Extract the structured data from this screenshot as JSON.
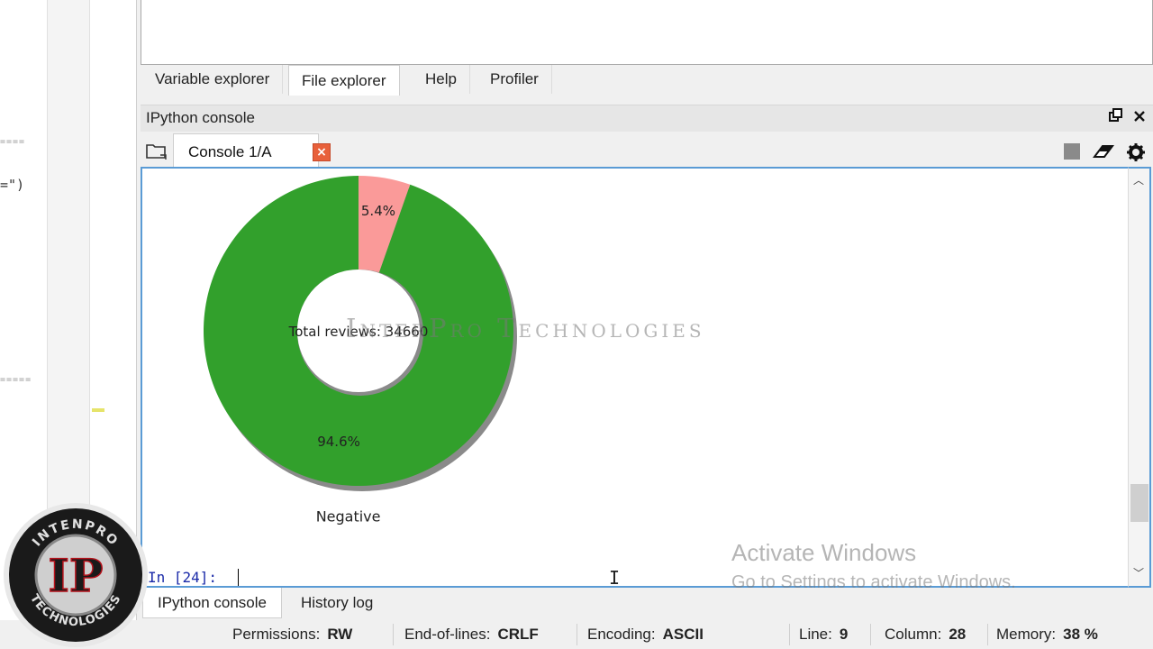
{
  "editor": {
    "fragment": "=\")"
  },
  "top_tabs": [
    {
      "label": "Variable explorer",
      "active": false
    },
    {
      "label": "File explorer",
      "active": true
    },
    {
      "label": "Help",
      "active": false
    },
    {
      "label": "Profiler",
      "active": false
    }
  ],
  "console_pane": {
    "title": "IPython console",
    "tab_label": "Console 1/A",
    "icons": [
      "folder-icon",
      "stop-icon",
      "eraser-icon",
      "gear-icon",
      "undock-icon",
      "close-icon"
    ]
  },
  "chart_data": {
    "type": "pie",
    "style": "donut",
    "values": [
      94.6,
      5.4
    ],
    "colors": [
      "#32a02c",
      "#fa9a99"
    ],
    "autopct_labels": [
      "94.6%",
      "5.4%"
    ],
    "slice_labels": [
      "Negative",
      ""
    ],
    "center_text": "Total reviews: 34660"
  },
  "watermark": "InterPro Technologies",
  "console": {
    "prompt": "In [24]:"
  },
  "activate_windows": {
    "line1": "Activate Windows",
    "line2": "Go to Settings to activate Windows."
  },
  "bottom_tabs": [
    {
      "label": "IPython console",
      "active": true
    },
    {
      "label": "History log",
      "active": false
    }
  ],
  "status": {
    "permissions_label": "Permissions:",
    "permissions_value": "RW",
    "eol_label": "End-of-lines:",
    "eol_value": "CRLF",
    "encoding_label": "Encoding:",
    "encoding_value": "ASCII",
    "line_label": "Line:",
    "line_value": "9",
    "column_label": "Column:",
    "column_value": "28",
    "memory_label": "Memory:",
    "memory_value": "38 %"
  },
  "logo": {
    "top_text": "INTENPRO",
    "bottom_text": "TECHNOLOGIES",
    "mark": "IP"
  }
}
